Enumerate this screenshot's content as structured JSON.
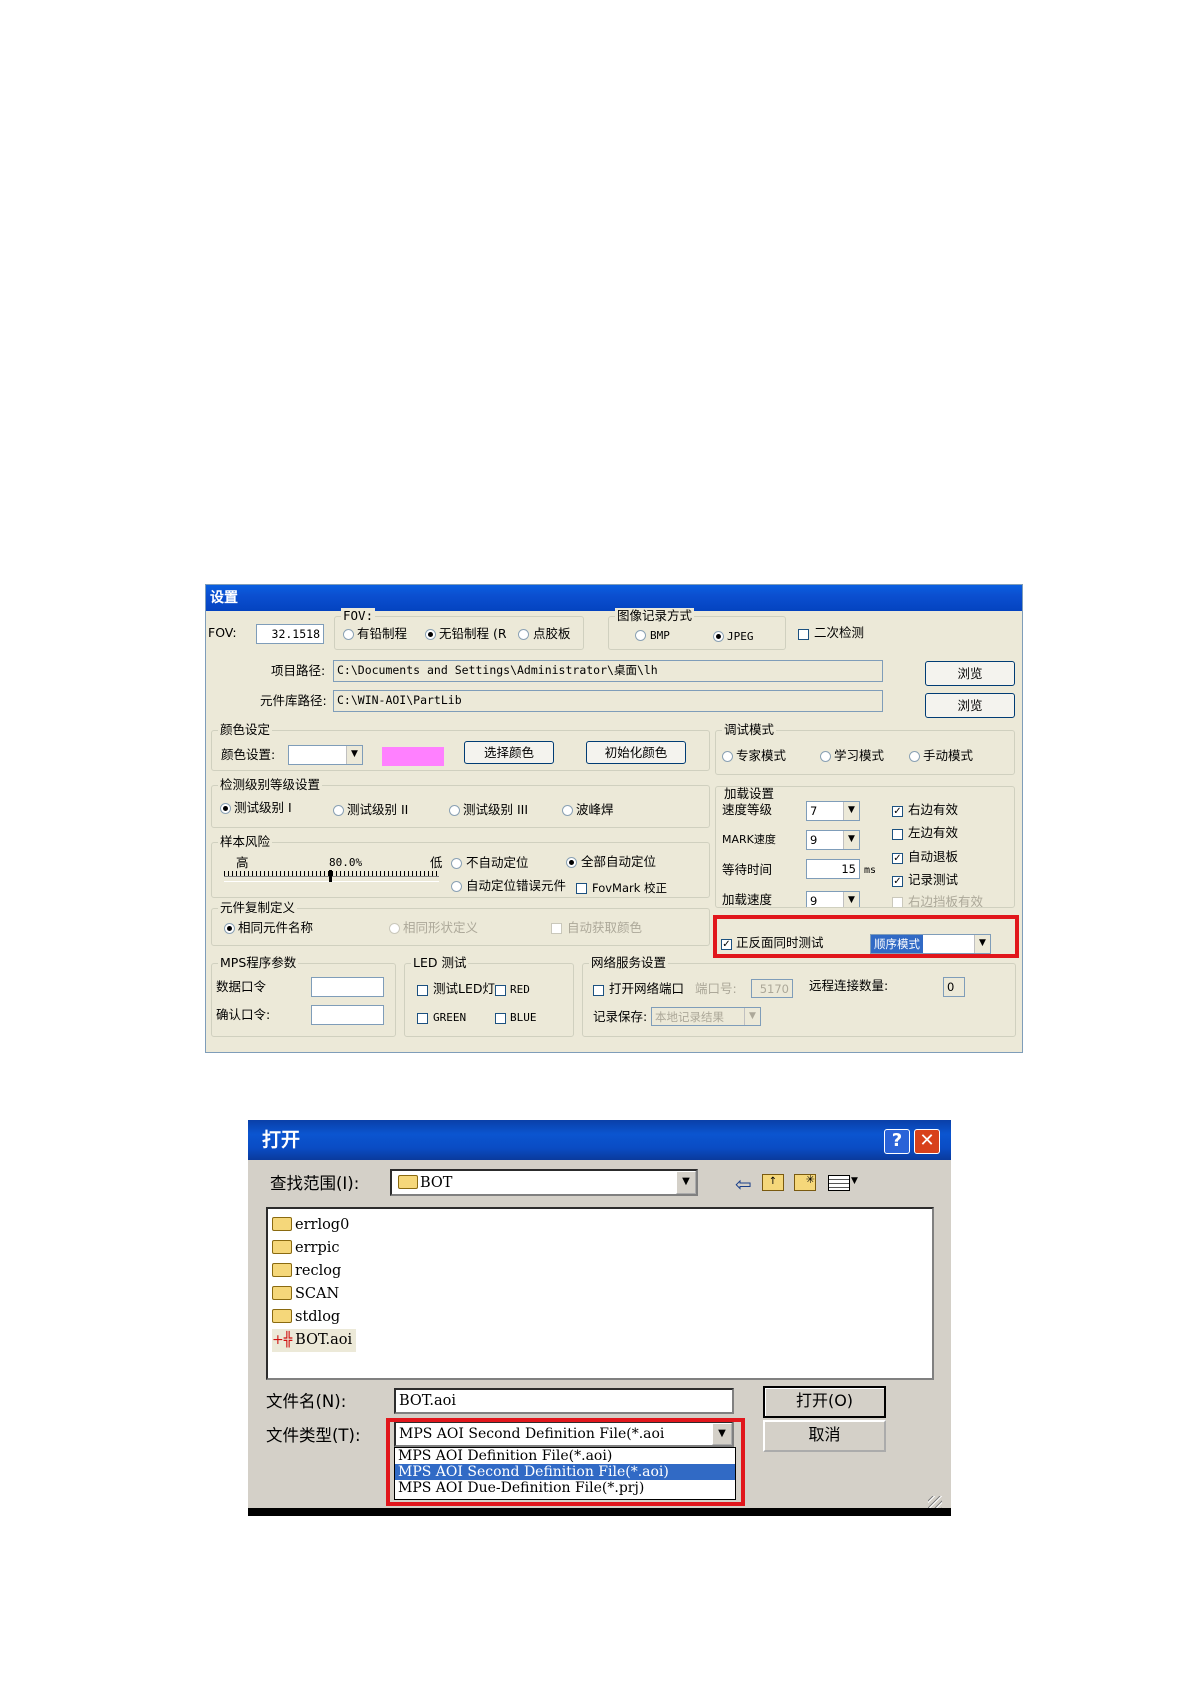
{
  "settings": {
    "title": "设置",
    "fov_label": "FOV:",
    "fov_value": "32.1518",
    "fov_group": {
      "title": "FOV:",
      "opt1": "有铅制程",
      "opt2": "无铅制程 (R",
      "opt3": "点胶板"
    },
    "img_group": {
      "title": "图像记录方式",
      "opt1": "BMP",
      "opt2": "JPEG"
    },
    "second_check": "二次检测",
    "project_path_label": "项目路径:",
    "project_path": "C:\\Documents and Settings\\Administrator\\桌面\\lh",
    "lib_path_label": "元件库路径:",
    "lib_path": "C:\\WIN-AOI\\PartLib",
    "browse1": "浏览",
    "browse2": "浏览",
    "color_group": {
      "title": "颜色设定",
      "label": "颜色设置:",
      "select_btn": "选择颜色",
      "init_btn": "初始化颜色",
      "swatch_color": "#ff80ff"
    },
    "debug_group": {
      "title": "调试模式",
      "opt1": "专家模式",
      "opt2": "学习模式",
      "opt3": "手动模式"
    },
    "level_group": {
      "title": "检测级别等级设置",
      "opt1": "测试级别 I",
      "opt2": "测试级别 II",
      "opt3": "测试级别 III",
      "opt4": "波峰焊"
    },
    "load_group": {
      "title": "加载设置",
      "speed_label": "速度等级",
      "speed_value": "7",
      "mark_label": "MARK速度",
      "mark_value": "9",
      "wait_label": "等待时间",
      "wait_value": "15",
      "wait_unit": "ms",
      "accel_label": "加载速度",
      "accel_value": "9",
      "right_valid": "右边有效",
      "left_valid": "左边有效",
      "auto_exit": "自动退板",
      "record_test": "记录测试",
      "right_baffle": "右边挡板有效"
    },
    "risk_group": {
      "title": "样本风险",
      "high": "高",
      "pct": "80.0%",
      "low": "低",
      "opt1": "不自动定位",
      "opt2": "全部自动定位",
      "opt3": "自动定位错误元件",
      "fov_mark": "FovMark 校正"
    },
    "copy_group": {
      "title": "元件复制定义",
      "opt1": "相同元件名称",
      "opt2": "相同形状定义",
      "opt3": "自动获取颜色"
    },
    "dual_test": {
      "label": "正反面同时测试",
      "mode": "顺序模式"
    },
    "mps_group": {
      "title": "MPS程序参数",
      "data_pwd": "数据口令",
      "confirm_pwd": "确认口令:"
    },
    "led_group": {
      "title": "LED 测试",
      "test_led": "测试LED灯",
      "red": "RED",
      "green": "GREEN",
      "blue": "BLUE"
    },
    "net_group": {
      "title": "网络服务设置",
      "open_port": "打开网络端口",
      "port_label": "端口号:",
      "port_value": "5170",
      "remote_label": "远程连接数量:",
      "remote_value": "0",
      "save_label": "记录保存:",
      "save_value": "本地记录结果"
    }
  },
  "open_dialog": {
    "title": "打开",
    "help_btn": "?",
    "close_btn": "✕",
    "lookin_label": "查找范围(I):",
    "lookin_value": "BOT",
    "files": [
      "errlog0",
      "errpic",
      "reclog",
      "SCAN",
      "stdlog",
      "BOT.aoi"
    ],
    "filename_label": "文件名(N):",
    "filename_value": "BOT.aoi",
    "filetype_label": "文件类型(T):",
    "filetype_value": "MPS AOI Second Definition File(*.aoi",
    "filetype_options": [
      "MPS AOI Definition File(*.aoi)",
      "MPS AOI Second Definition File(*.aoi)",
      "MPS AOI Due-Definition File(*.prj)"
    ],
    "open_btn": "打开(O)",
    "cancel_btn": "取消"
  },
  "colors": {
    "highlight_red": "#e1161c",
    "xp_blue": "#0b4fd0",
    "selection": "#316ac5"
  }
}
